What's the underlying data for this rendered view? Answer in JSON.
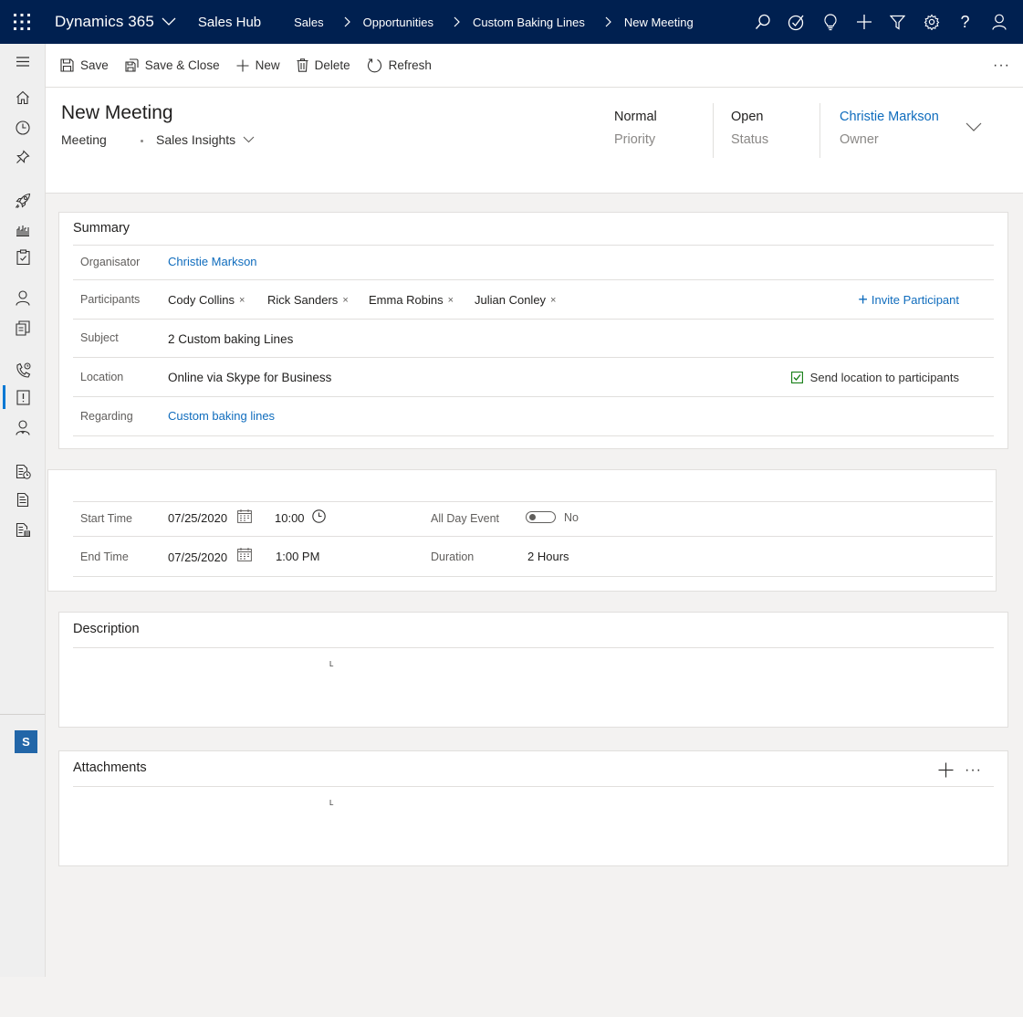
{
  "topbar": {
    "app_name": "Dynamics 365",
    "hub_name": "Sales Hub",
    "breadcrumbs": [
      "Sales",
      "Opportunities",
      "Custom Baking Lines",
      "New Meeting"
    ],
    "action_icons": [
      "search-icon",
      "task-check-icon",
      "lightbulb-icon",
      "plus-icon",
      "filter-icon",
      "gear-icon",
      "help-icon",
      "user-icon"
    ],
    "help_glyph": "?"
  },
  "leftnav": {
    "items": [
      "hamburger-icon",
      "home-icon",
      "recent-icon",
      "pinned-icon",
      "rocket-icon",
      "dashboard-icon",
      "activities-icon",
      "contact-icon",
      "accounts-icon",
      "phone-call-icon",
      "task-icon",
      "user-profile-icon",
      "document-clock-icon",
      "document-icon",
      "document-stack-icon"
    ],
    "active_item": "task-icon",
    "area_badge": "S"
  },
  "commandbar": {
    "save": "Save",
    "save_close": "Save & Close",
    "new": "New",
    "delete": "Delete",
    "refresh": "Refresh",
    "more": "···"
  },
  "header": {
    "title": "New Meeting",
    "entity": "Meeting",
    "form_selector": "Sales Insights",
    "priority_value": "Normal",
    "priority_label": "Priority",
    "status_value": "Open",
    "status_label": "Status",
    "owner_value": "Christie Markson",
    "owner_label": "Owner"
  },
  "summary": {
    "title": "Summary",
    "organisator_label": "Organisator",
    "organisator_value": "Christie Markson",
    "participants_label": "Participants",
    "participants": [
      "Cody Collins",
      "Rick Sanders",
      "Emma Robins",
      "Julian Conley"
    ],
    "remove_glyph": "×",
    "invite_label": "Invite Participant",
    "invite_glyph": "+",
    "subject_label": "Subject",
    "subject_value": "2 Custom baking Lines",
    "location_label": "Location",
    "location_value": "Online via Skype for Business",
    "send_location_label": "Send location to participants",
    "regarding_label": "Regarding",
    "regarding_value": "Custom baking lines"
  },
  "schedule": {
    "start_label": "Start Time",
    "start_date": "07/25/2020",
    "start_time": "10:00",
    "end_label": "End Time",
    "end_date": "07/25/2020",
    "end_time": "1:00 PM",
    "all_day_label": "All Day Event",
    "all_day_value": "No",
    "duration_label": "Duration",
    "duration_value": "2 Hours"
  },
  "description": {
    "title": "Description",
    "cursor_glyph": "L"
  },
  "attachments": {
    "title": "Attachments",
    "add_glyph": "+",
    "more_glyph": "···",
    "cursor_glyph": "L"
  },
  "colors": {
    "topbar_bg": "#002050",
    "accent": "#0078d4",
    "link": "#0f6cbd",
    "badge_bg": "#2266a8",
    "checkbox_green": "#107c10"
  }
}
